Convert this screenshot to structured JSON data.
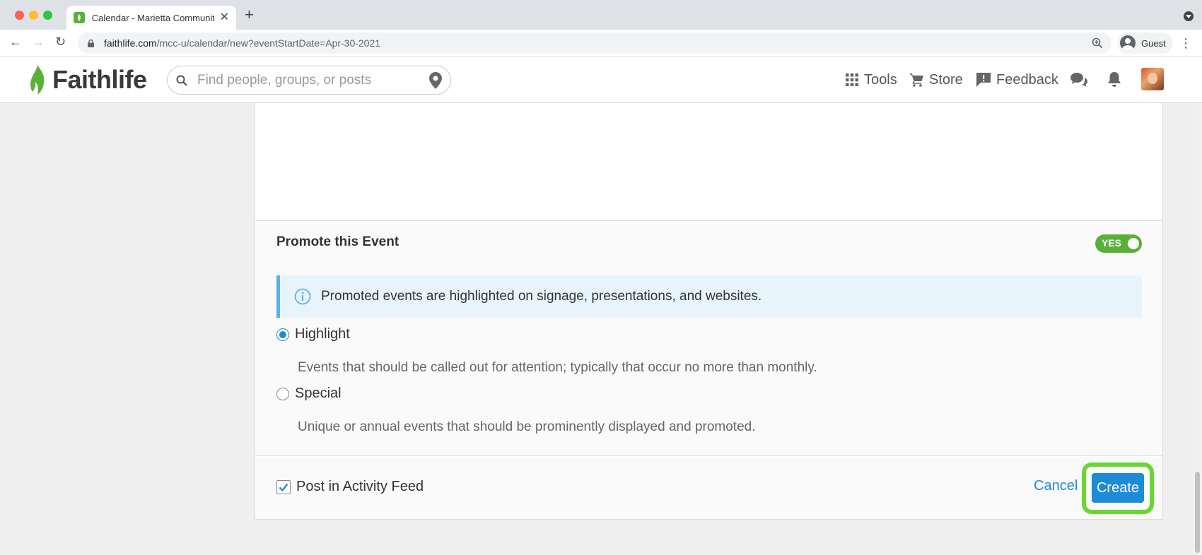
{
  "browser": {
    "tab_title": "Calendar - Marietta Community",
    "tab_close": "✕",
    "new_tab": "+",
    "url_host": "faithlife.com",
    "url_path": "/mcc-u/calendar/new?eventStartDate=Apr-30-2021",
    "profile_label": "Guest",
    "back_icon": "←",
    "forward_icon": "→",
    "reload_icon": "↻",
    "menu_icon": "⋮"
  },
  "header": {
    "logo_text": "Faithlife",
    "search_placeholder": "Find people, groups, or posts",
    "nav": {
      "tools": "Tools",
      "store": "Store",
      "feedback": "Feedback"
    }
  },
  "promote": {
    "title": "Promote this Event",
    "toggle_label": "YES",
    "info_text": "Promoted events are highlighted on signage, presentations, and websites.",
    "options": [
      {
        "label": "Highlight",
        "description": "Events that should be called out for attention; typically that occur no more than monthly.",
        "selected": true
      },
      {
        "label": "Special",
        "description": "Unique or annual events that should be prominently displayed and promoted.",
        "selected": false
      }
    ]
  },
  "footer": {
    "post_feed_label": "Post in Activity Feed",
    "post_feed_checked": true,
    "cancel_label": "Cancel",
    "create_label": "Create"
  },
  "colors": {
    "brand_green": "#5ab039",
    "link_blue": "#1e8bd9",
    "info_border": "#5bb2e5",
    "highlight_ring": "#6bd631"
  }
}
